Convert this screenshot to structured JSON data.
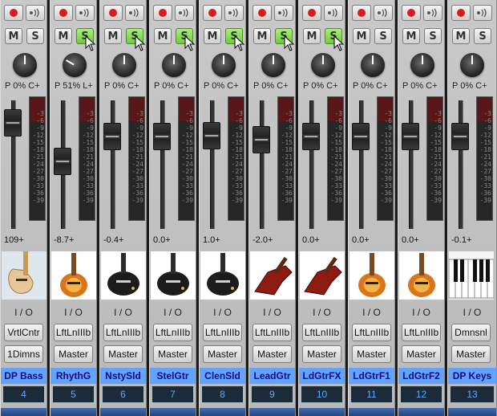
{
  "labels": {
    "pan_prefix": "P",
    "pan_suffix": "C+",
    "io": "I / O",
    "mute": "M",
    "solo": "S",
    "output": "Master"
  },
  "colors": {
    "record": "#d81b1b",
    "solo_active": "#7fd44a",
    "name_bar": "#62a3ff",
    "name_text": "#0c0c7d",
    "track_number": "#5ea8ff"
  },
  "meter_scale": [
    "-3",
    "-6",
    "-9",
    "-12",
    "-15",
    "-18",
    "-21",
    "-24",
    "-27",
    "-30",
    "-33",
    "-36",
    "-39"
  ],
  "tracks": [
    {
      "name": "DP Bass",
      "number": "4",
      "volume": "109+",
      "pan": "0%",
      "pan_label": "C+",
      "input": "VrtlCntr",
      "output": "1Dimns",
      "solo": false,
      "image": "bass-guitar",
      "fader": 0.92,
      "knob": 0
    },
    {
      "name": "RhythG",
      "number": "5",
      "volume": "-8.7+",
      "pan": "51%",
      "pan_label": "L+",
      "input": "LftLnIIIb",
      "output": "Master",
      "solo": true,
      "image": "sunburst-guitar",
      "fader": 0.58,
      "knob": -60
    },
    {
      "name": "NstySld",
      "number": "6",
      "volume": "-0.4+",
      "pan": "0%",
      "pan_label": "C+",
      "input": "LftLnIIIb",
      "output": "Master",
      "solo": true,
      "image": "black-guitar",
      "fader": 0.8,
      "knob": 0
    },
    {
      "name": "StelGtr",
      "number": "7",
      "volume": "0.0+",
      "pan": "0%",
      "pan_label": "C+",
      "input": "LftLnIIIb",
      "output": "Master",
      "solo": true,
      "image": "black-guitar",
      "fader": 0.8,
      "knob": 0
    },
    {
      "name": "ClenSld",
      "number": "8",
      "volume": "1.0+",
      "pan": "0%",
      "pan_label": "C+",
      "input": "LftLnIIIb",
      "output": "Master",
      "solo": true,
      "image": "black-guitar",
      "fader": 0.81,
      "knob": 0
    },
    {
      "name": "LeadGtr",
      "number": "9",
      "volume": "-2.0+",
      "pan": "0%",
      "pan_label": "C+",
      "input": "LftLnIIIb",
      "output": "Master",
      "solo": true,
      "image": "red-guitar",
      "fader": 0.77,
      "knob": 0
    },
    {
      "name": "LdGtrFX",
      "number": "10",
      "volume": "0.0+",
      "pan": "0%",
      "pan_label": "C+",
      "input": "LftLnIIIb",
      "output": "Master",
      "solo": true,
      "image": "red-guitar",
      "fader": 0.8,
      "knob": 0
    },
    {
      "name": "LdGtrF1",
      "number": "11",
      "volume": "0.0+",
      "pan": "0%",
      "pan_label": "C+",
      "input": "LftLnIIIb",
      "output": "Master",
      "solo": false,
      "image": "sunburst-guitar",
      "fader": 0.8,
      "knob": 0
    },
    {
      "name": "LdGtrF2",
      "number": "12",
      "volume": "0.0+",
      "pan": "0%",
      "pan_label": "C+",
      "input": "LftLnIIIb",
      "output": "Master",
      "solo": false,
      "image": "sunburst-guitar",
      "fader": 0.8,
      "knob": 0
    },
    {
      "name": "DP Keys",
      "number": "13",
      "volume": "-0.1+",
      "pan": "0%",
      "pan_label": "C+",
      "input": "Dmnsnl",
      "output": "Master",
      "solo": false,
      "image": "piano-keys",
      "fader": 0.8,
      "knob": 0
    }
  ]
}
